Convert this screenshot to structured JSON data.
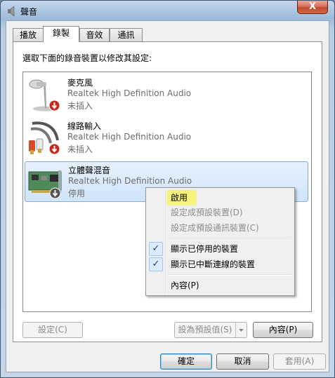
{
  "window": {
    "title": "聲音",
    "close_label": "X"
  },
  "tabs": [
    {
      "label": "播放",
      "active": false
    },
    {
      "label": "錄製",
      "active": true
    },
    {
      "label": "音效",
      "active": false
    },
    {
      "label": "通訊",
      "active": false
    }
  ],
  "panel": {
    "instruction": "選取下面的錄音裝置以修改其設定:"
  },
  "devices": [
    {
      "name": "麥克風",
      "description": "Realtek High Definition Audio",
      "status": "未插入",
      "icon": "microphone-icon",
      "badge": "disconnected-badge-icon"
    },
    {
      "name": "線路輸入",
      "description": "Realtek High Definition Audio",
      "status": "未插入",
      "icon": "line-in-cable-icon",
      "badge": "disconnected-badge-icon"
    },
    {
      "name": "立體聲混音",
      "description": "Realtek High Definition Audio",
      "status": "停用",
      "icon": "sound-card-icon",
      "badge": "disabled-badge-icon",
      "selected": true
    }
  ],
  "context_menu": {
    "items": [
      {
        "label": "啟用",
        "disabled": false,
        "highlighted": true
      },
      {
        "label": "設定成預設裝置(D)",
        "disabled": true
      },
      {
        "label": "設定成預設通訊裝置(C)",
        "disabled": true
      },
      {
        "label": "顯示已停用的裝置",
        "checked": true
      },
      {
        "label": "顯示已中斷連線的裝置",
        "checked": true
      },
      {
        "label": "內容(P)",
        "disabled": false
      }
    ],
    "check_glyph": "✓",
    "highlight_color": "#f8f37a"
  },
  "buttons": {
    "configure": "設定(C)",
    "set_default": "設為預設值(S)",
    "properties": "內容(P)",
    "ok": "確定",
    "cancel": "取消",
    "apply": "套用(A)"
  },
  "colors": {
    "selection": "#cfe4fa",
    "accent_red": "#c8281e"
  }
}
